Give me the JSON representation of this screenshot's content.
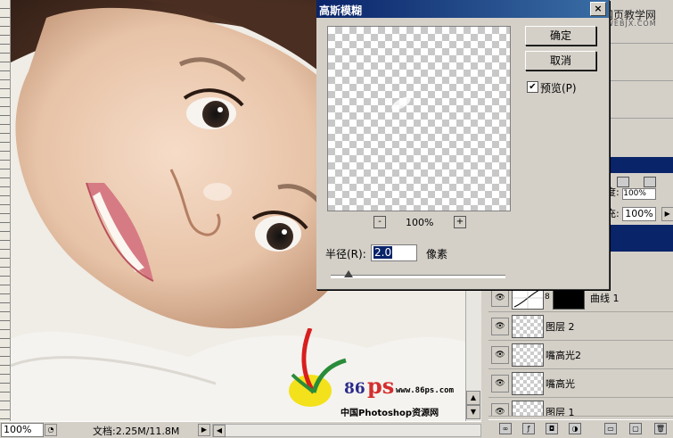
{
  "dialog": {
    "title": "高斯模糊",
    "close_label": "×",
    "ok_label": "确定",
    "cancel_label": "取消",
    "preview_checkbox_label": "预览(P)",
    "preview_checked": true,
    "zoom_out_label": "-",
    "zoom_in_label": "+",
    "zoom_percent": "100%",
    "radius_label": "半径(R):",
    "radius_value": "2.0",
    "unit_label": "像素",
    "slider_level_fraction": 0.1
  },
  "statusbar": {
    "zoom": "100%",
    "doc_info": "文档:2.25M/11.8M"
  },
  "watermark": {
    "brand_86": "86",
    "brand_ps": "ps",
    "url": "www.86ps.com",
    "cn_name": "中国Photoshop资源网"
  },
  "site_logo": {
    "name": "网页教学网",
    "sub": "WEBJX.COM"
  },
  "layers_panel": {
    "opacity_prefix": "度:",
    "opacity_value": "100%",
    "fill_label": "充:",
    "fill_value": "100%",
    "layers": [
      {
        "name": "曲线 1",
        "type": "curves-adjustment"
      },
      {
        "name": "图层 2",
        "type": "pixel"
      },
      {
        "name": "嘴高光2",
        "type": "pixel"
      },
      {
        "name": "嘴高光",
        "type": "pixel"
      },
      {
        "name": "图层 1",
        "type": "pixel"
      }
    ]
  },
  "icons": {
    "eye": "eye-icon",
    "link": "chain-link-icon",
    "close": "close-icon"
  },
  "colors": {
    "titlebar_start": "#0a246a",
    "titlebar_end": "#3a6ea5",
    "selection": "#0a246a",
    "dialog_bg": "#d4d0c8"
  }
}
